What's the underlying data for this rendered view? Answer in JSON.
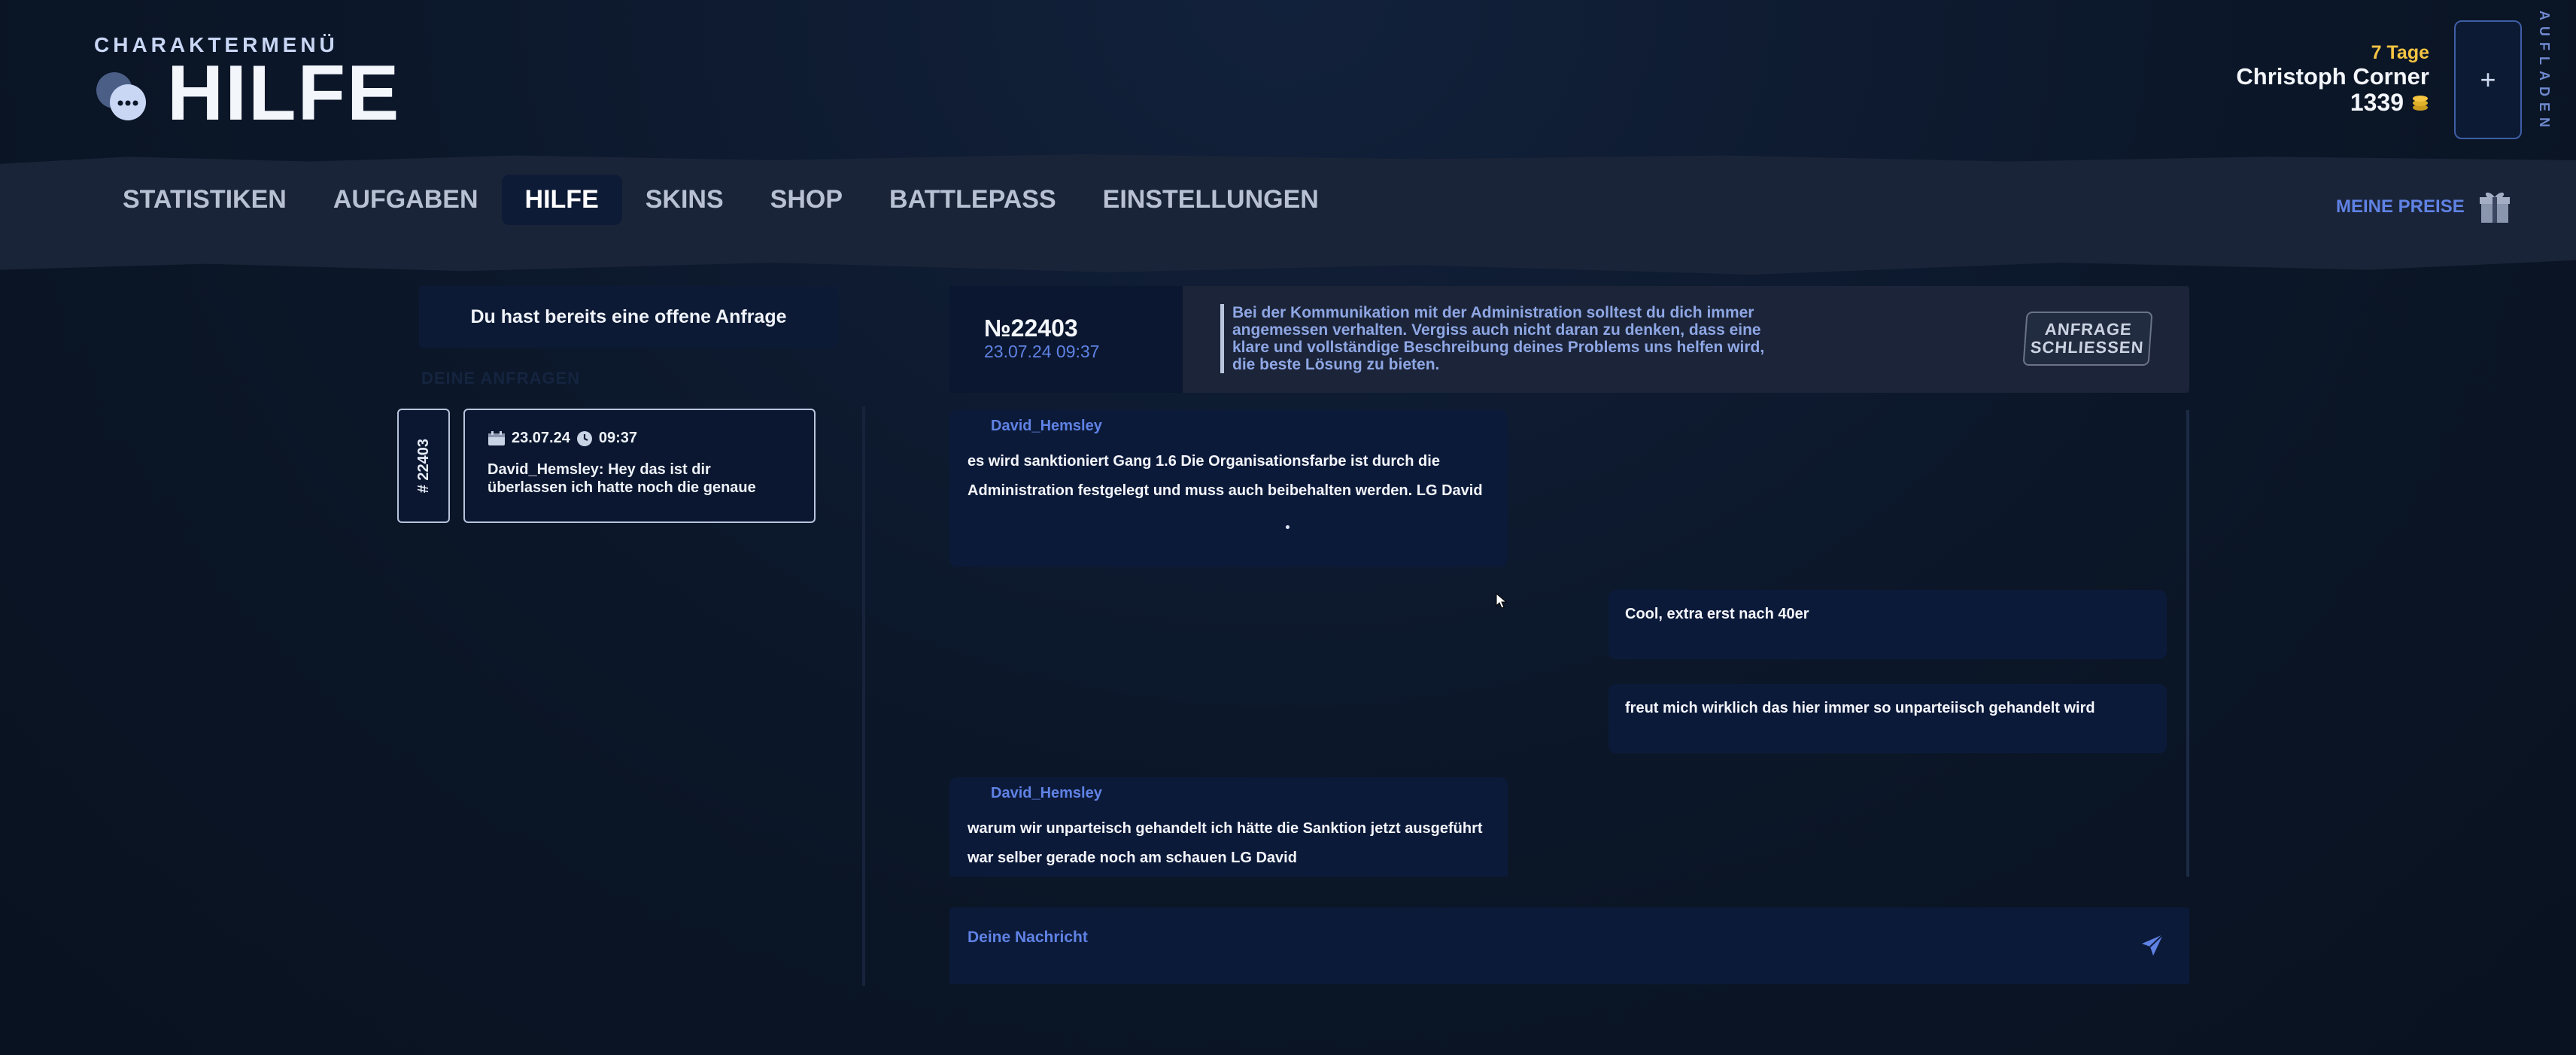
{
  "header": {
    "section_label": "CHARAKTERMENÜ",
    "title": "HILFE",
    "user": {
      "days": "7 Tage",
      "name": "Christoph Corner",
      "coins": "1339"
    },
    "topup_plus": "+",
    "topup_label": "AUFLADEN"
  },
  "nav": {
    "items": [
      "STATISTIKEN",
      "AUFGABEN",
      "HILFE",
      "SKINS",
      "SHOP",
      "BATTLEPASS",
      "EINSTELLUNGEN"
    ],
    "active": "HILFE",
    "prices_label": "MEINE PREISE"
  },
  "sidebar": {
    "open_request": "Du hast bereits eine offene Anfrage",
    "section_label": "DEINE ANFRAGEN",
    "ticket": {
      "id": "# 22403",
      "date": "23.07.24",
      "time": "09:37",
      "preview": "David_Hemsley: Hey das ist dir überlassen ich hatte noch die genaue Begründung"
    }
  },
  "ticket_header": {
    "number": "№22403",
    "datetime": "23.07.24 09:37",
    "info": "Bei der Kommunikation mit der Administration solltest du dich immer angemessen verhalten. Vergiss auch nicht daran zu denken, dass eine klare und vollständige Beschreibung deines Problems uns helfen wird, die beste Lösung zu bieten.",
    "close_button": "ANFRAGE SCHLIESSEN"
  },
  "messages": [
    {
      "side": "left",
      "author": "David_Hemsley",
      "text": "es wird sanktioniert Gang 1.6 Die Organisationsfarbe ist durch die Administration festgelegt und muss auch beibehalten werden. LG David"
    },
    {
      "side": "right",
      "author": "",
      "text": "Cool, extra erst nach 40er"
    },
    {
      "side": "right",
      "author": "",
      "text": "freut mich wirklich das hier immer so unparteiisch gehandelt wird"
    },
    {
      "side": "left",
      "author": "David_Hemsley",
      "text": "warum wir unparteisch gehandelt ich hätte die Sanktion jetzt ausgeführt war selber gerade noch am schauen LG David"
    }
  ],
  "composer": {
    "placeholder": "Deine Nachricht"
  },
  "colors": {
    "accent": "#5f82e4",
    "gold": "#f5c542",
    "panel": "#0c1a3a",
    "nav_band": "#1a2438"
  }
}
